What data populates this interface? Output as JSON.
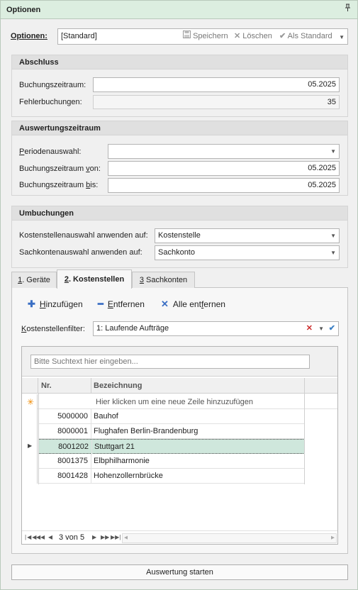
{
  "panel": {
    "title": "Optionen",
    "pin_icon": "pin-icon"
  },
  "options": {
    "label": "Optionen:",
    "value": "[Standard]",
    "save": "Speichern",
    "delete": "Löschen",
    "as_default": "Als Standard"
  },
  "abschluss": {
    "header": "Abschluss",
    "buchungszeitraum_label": "Buchungszeitraum:",
    "buchungszeitraum_value": "05.2025",
    "fehlerbuchungen_label": "Fehlerbuchungen:",
    "fehlerbuchungen_value": "35"
  },
  "auswertung": {
    "header": "Auswertungszeitraum",
    "periode_label": "Periodenauswahl:",
    "periode_value": "",
    "von_label": "Buchungszeitraum von:",
    "von_value": "05.2025",
    "bis_label": "Buchungszeitraum bis:",
    "bis_value": "05.2025"
  },
  "umbuchungen": {
    "header": "Umbuchungen",
    "kst_label": "Kostenstellenauswahl anwenden auf:",
    "kst_value": "Kostenstelle",
    "sk_label": "Sachkontenauswahl anwenden auf:",
    "sk_value": "Sachkonto"
  },
  "tabs": [
    {
      "num": "1",
      "label": ". Geräte"
    },
    {
      "num": "2",
      "label": ". Kostenstellen"
    },
    {
      "num": "3",
      "label": " Sachkonten"
    }
  ],
  "actions": {
    "add": "Hinzufügen",
    "remove": "Entfernen",
    "remove_all": "Alle entfernen"
  },
  "filter": {
    "label": "Kostenstellenfilter:",
    "value": "1: Laufende Aufträge"
  },
  "grid": {
    "search_placeholder": "Bitte Suchtext hier eingeben...",
    "col_nr": "Nr.",
    "col_bez": "Bezeichnung",
    "new_row_hint": "Hier klicken um eine neue Zeile hinzuzufügen",
    "rows": [
      {
        "nr": "5000000",
        "bez": "Bauhof"
      },
      {
        "nr": "8000001",
        "bez": "Flughafen Berlin-Brandenburg"
      },
      {
        "nr": "8001202",
        "bez": "Stuttgart 21"
      },
      {
        "nr": "8001375",
        "bez": "Elbphilharmonie"
      },
      {
        "nr": "8001428",
        "bez": "Hohenzollernbrücke"
      }
    ],
    "pager": "3 von 5"
  },
  "start_button": "Auswertung starten",
  "colors": {
    "accent": "#3b6fc4",
    "title_bg": "#dceee0",
    "selected_row": "#cfe7dc",
    "delete_x": "#cc2b2b",
    "check": "#3b7fc4"
  }
}
